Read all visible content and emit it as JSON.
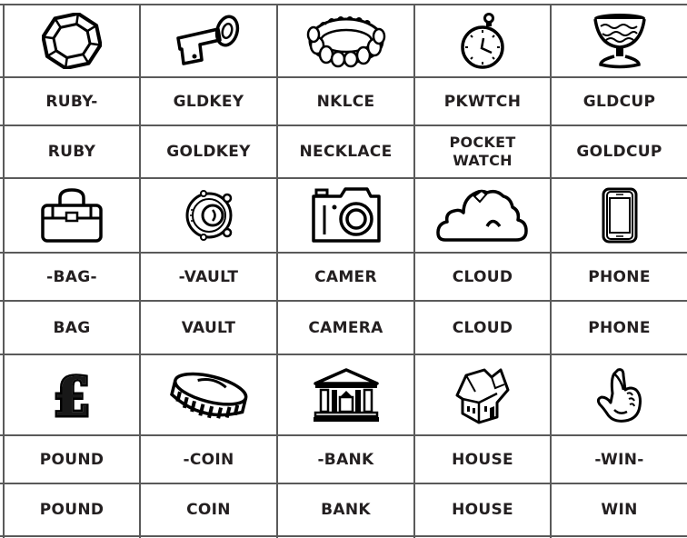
{
  "worksheet": {
    "columns": 5,
    "blocks": [
      {
        "icons": [
          "ruby-gem-icon",
          "gold-key-icon",
          "necklace-icon",
          "pocket-watch-icon",
          "gold-cup-icon"
        ],
        "abbreviations": [
          "RUBY-",
          "GLDKEY",
          "NKLCE",
          "PKWTCH",
          "GLDCUP"
        ],
        "words": [
          "RUBY",
          "GOLDKEY",
          "NECKLACE",
          "POCKET WATCH",
          "GOLDCUP"
        ]
      },
      {
        "icons": [
          "bag-icon",
          "vault-icon",
          "camera-icon",
          "cloud-icon",
          "phone-icon"
        ],
        "abbreviations": [
          "-BAG-",
          "-VAULT",
          "CAMER",
          "CLOUD",
          "PHONE"
        ],
        "words": [
          "BAG",
          "VAULT",
          "CAMERA",
          "CLOUD",
          "PHONE"
        ]
      },
      {
        "icons": [
          "pound-sign-icon",
          "coin-icon",
          "bank-icon",
          "house-icon",
          "crossed-fingers-icon"
        ],
        "abbreviations": [
          "POUND",
          "-COIN",
          "-BANK",
          "HOUSE",
          "-WIN-"
        ],
        "words": [
          "POUND",
          "COIN",
          "BANK",
          "HOUSE",
          "WIN"
        ]
      }
    ],
    "pocket_watch_lines": [
      "POCKET",
      "WATCH"
    ],
    "pound_symbol": "£",
    "line_color": "#5a5a5a",
    "ink_color": "#231f20"
  }
}
